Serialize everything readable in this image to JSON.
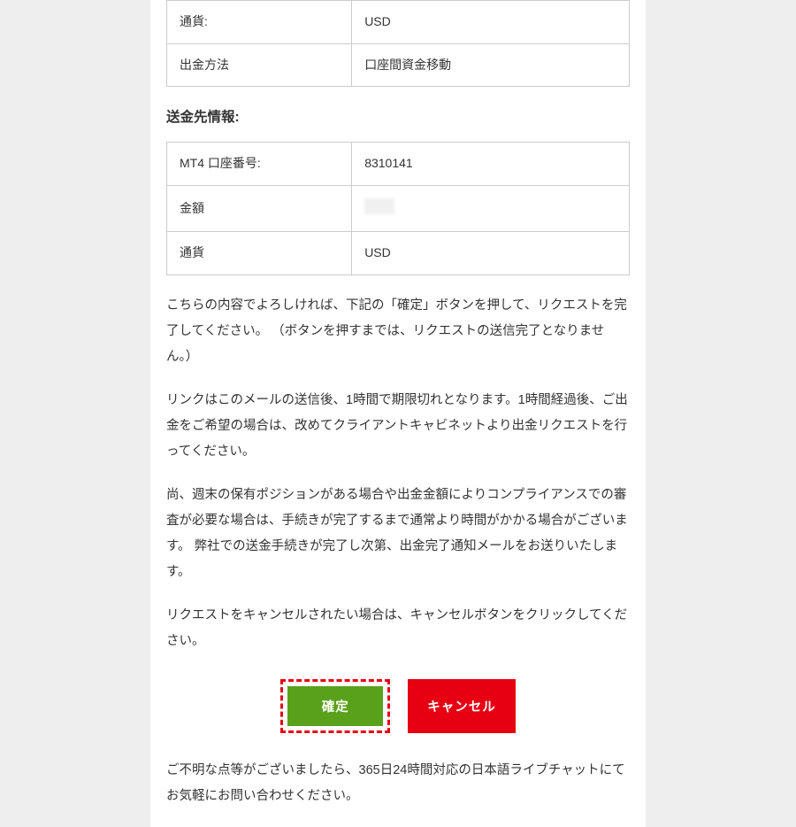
{
  "source_table": {
    "currency_label": "通貨:",
    "currency_value": "USD",
    "method_label": "出金方法",
    "method_value": "口座間資金移動"
  },
  "destination_heading": "送金先情報:",
  "destination_table": {
    "account_label": "MT4 口座番号:",
    "account_value": "8310141",
    "amount_label": "金額",
    "amount_value": "",
    "currency_label": "通貨",
    "currency_value": "USD"
  },
  "paragraphs": {
    "p1": "こちらの内容でよろしければ、下記の「確定」ボタンを押して、リクエストを完了してください。 （ボタンを押すまでは、リクエストの送信完了となりません。）",
    "p2": "リンクはこのメールの送信後、1時間で期限切れとなります。1時間経過後、ご出金をご希望の場合は、改めてクライアントキャビネットより出金リクエストを行ってください。",
    "p3": "尚、週末の保有ポジションがある場合や出金金額によりコンプライアンスでの審査が必要な場合は、手続きが完了するまで通常より時間がかかる場合がございます。 弊社での送金手続きが完了し次第、出金完了通知メールをお送りいたします。",
    "p4": "リクエストをキャンセルされたい場合は、キャンセルボタンをクリックしてください。",
    "p5": "ご不明な点等がございましたら、365日24時間対応の日本語ライブチャットにてお気軽にお問い合わせください。"
  },
  "buttons": {
    "confirm": "確定",
    "cancel": "キャンセル"
  }
}
